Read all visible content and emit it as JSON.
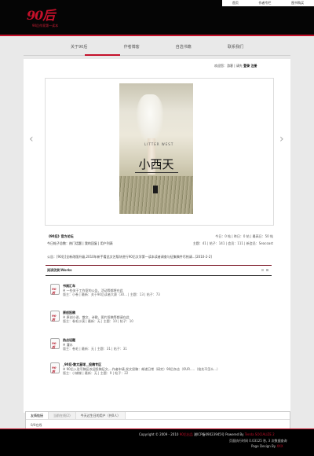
{
  "topbar": {
    "links": [
      "首页",
      "作者专栏",
      "图书购买"
    ]
  },
  "logo": {
    "mark": "90后",
    "tagline": "90后作家第一读本"
  },
  "nav": [
    "关于90后",
    "作者博客",
    "自选书籍",
    "联系我们"
  ],
  "welcome": {
    "text": "欢迎您：游客 | 请先",
    "login": "登录",
    "register": "注册"
  },
  "slider": {
    "prev": "‹",
    "next": "›"
  },
  "cover": {
    "subtitle": "LITTER WEST",
    "title": "小西天",
    "badge": "一"
  },
  "forum_info": {
    "title": "《90后》官方论坛",
    "sub": "今日帖子总数：热门话题 | 我的回复 | 用户列表",
    "stats": "今日：0 帖 | 昨日：0 帖 | 最高日：50 帖",
    "members": "主题：41 | 帖子：141 | 会员：111 | 新会员：Seacoast"
  },
  "notice": "公告：[90后]全新改版升级,2010年新手看此文艺版块进行90后文学第一读本读者调查与征集稿件尽热请...[2010-2-2]",
  "board": {
    "title": "阅读欣赏/Works"
  },
  "forums": [
    {
      "icon": "90后",
      "name": "书阅汇车",
      "desc": "※ 一些关于工作室的公告、活动等都将在此",
      "stats": "版主：小卷 | 最新：关于90后读者大赛（30... | 主题：13 | 帖子：73"
    },
    {
      "icon": "90后",
      "name": "原创投稿",
      "desc": "※ 原创小说、散文、诗歌、图片投稿等都请在此",
      "stats": "版主：卷毛沙漠 | 最新：无 | 主题：10 | 帖子：10"
    },
    {
      "icon": "90后",
      "name": "热点话题",
      "desc": "※ 灌水",
      "stats": "版主：卷毛 | 最新：无 | 主题：31 | 帖子：31"
    },
    {
      "icon": "90后",
      "name": "_90后·散文星球__投稿专区",
      "desc": "※ 90后入驻写稿区欢迎投稿征文,...作者申请,发文投稿：邮递日常（研究）90后杂志（OUR.....（抢先不怎么...）",
      "stats": "版主：小蝴蝶 | 最新：无 | 主题：9 | 帖子：22"
    }
  ],
  "links": {
    "tabs": [
      "友情链接",
      "当前在线(2)",
      "今天过生日的用户（共0人）"
    ],
    "body": "0/0在线"
  },
  "footer": {
    "line1_pre": "Copyright © 2009 - 2010",
    "line1_red": "90后出品",
    "line1_mid": "湘ICP备09023945号   Powered By",
    "line1_red2": "Tenda SOCIALIZE 2",
    "line2": "页面执行时间 0.03125 秒, 3 次数据查询",
    "line3_pre": "Page Design By",
    "line3_red": "XXX"
  },
  "colors": {
    "accent": "#c4102a",
    "header_bg": "#050505"
  }
}
